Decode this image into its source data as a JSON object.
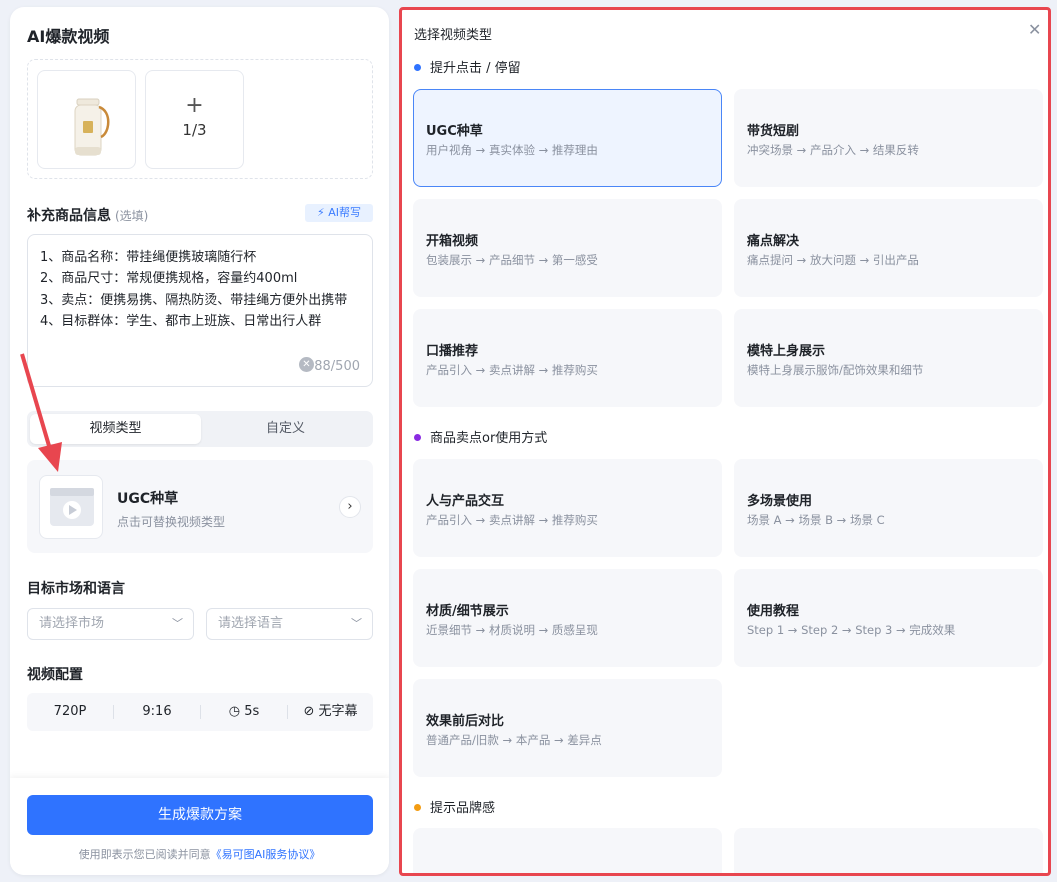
{
  "left": {
    "title": "AI爆款视频",
    "upload": {
      "add_symbol": "+",
      "count": "1/3"
    },
    "product_info": {
      "label": "补充商品信息",
      "optional": "(选填)",
      "ai_button": "AI帮写",
      "text": "1、商品名称：带挂绳便携玻璃随行杯\n2、商品尺寸：常规便携规格，容量约400ml\n3、卖点：便携易携、隔热防烫、带挂绳方便外出携带\n4、目标群体：学生、都市上班族、日常出行人群",
      "char_count": "88/500"
    },
    "tabs": [
      "视频类型",
      "自定义"
    ],
    "selected_type": {
      "name": "UGC种草",
      "hint": "点击可替换视频类型"
    },
    "market": {
      "label": "目标市场和语言",
      "market_placeholder": "请选择市场",
      "language_placeholder": "请选择语言"
    },
    "video_config": {
      "label": "视频配置",
      "resolution": "720P",
      "ratio": "9:16",
      "duration": "5s",
      "subtitle": "无字幕"
    },
    "footer": {
      "button": "生成爆款方案",
      "agree_prefix": "使用即表示您已阅读并同意",
      "agree_link": "《易可图AI服务协议》"
    }
  },
  "right": {
    "title": "选择视频类型",
    "groups": [
      {
        "name": "提升点击 / 停留",
        "dot_color": "#2f73ff",
        "cards": [
          {
            "title": "UGC种草",
            "desc": "用户视角 → 真实体验 → 推荐理由",
            "selected": true
          },
          {
            "title": "带货短剧",
            "desc": "冲突场景 → 产品介入 → 结果反转"
          },
          {
            "title": "开箱视频",
            "desc": "包装展示 → 产品细节 → 第一感受"
          },
          {
            "title": "痛点解决",
            "desc": "痛点提问 → 放大问题 → 引出产品"
          },
          {
            "title": "口播推荐",
            "desc": "产品引入 → 卖点讲解 → 推荐购买"
          },
          {
            "title": "模特上身展示",
            "desc": "模特上身展示服饰/配饰效果和细节"
          }
        ]
      },
      {
        "name": "商品卖点or使用方式",
        "dot_color": "#8a2be2",
        "cards": [
          {
            "title": "人与产品交互",
            "desc": "产品引入 → 卖点讲解 → 推荐购买"
          },
          {
            "title": "多场景使用",
            "desc": "场景 A → 场景 B → 场景 C"
          },
          {
            "title": "材质/细节展示",
            "desc": "近景细节 → 材质说明 → 质感呈现"
          },
          {
            "title": "使用教程",
            "desc": "Step 1 → Step 2 → Step 3 → 完成效果"
          },
          {
            "title": "效果前后对比",
            "desc": "普通产品/旧款 → 本产品 → 差异点"
          }
        ]
      },
      {
        "name": "提示品牌感",
        "dot_color": "#f39c12",
        "cards": []
      }
    ]
  },
  "colors": {
    "accent": "#2f73ff",
    "highlight_border": "#e8464f"
  }
}
